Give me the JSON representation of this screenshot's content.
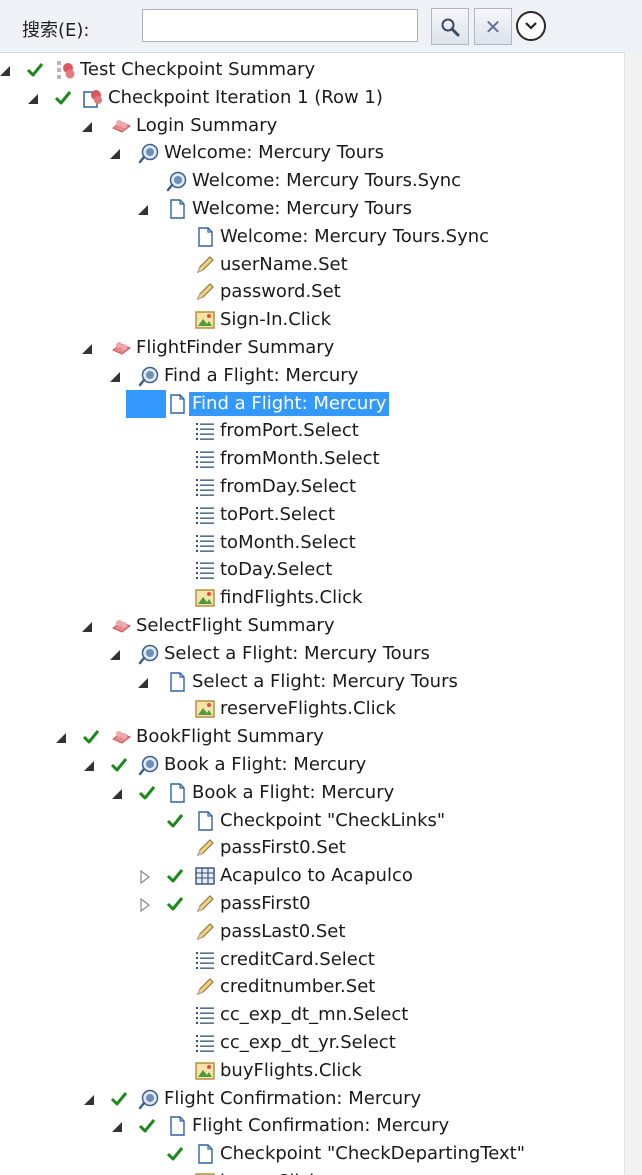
{
  "search": {
    "label": "搜索(E):",
    "value": "",
    "placeholder": ""
  },
  "toolbar": {
    "search_icon": "magnifier-icon",
    "clear_icon": "close-icon",
    "clear_glyph": "✕",
    "options_icon": "chevron-down-circle-icon"
  },
  "colors": {
    "selection": "#3399ff",
    "check": "#1a8a1a",
    "expander": "#333333"
  },
  "rows": [
    {
      "level": 0,
      "expander": "expanded",
      "check": true,
      "icon": "test-summary-icon",
      "label": "Test Checkpoint Summary"
    },
    {
      "level": 1,
      "expander": "expanded",
      "check": true,
      "icon": "iteration-icon",
      "label": "Checkpoint Iteration 1 (Row 1)"
    },
    {
      "level": 2,
      "expander": "expanded",
      "check": false,
      "icon": "action-icon",
      "label": "Login Summary"
    },
    {
      "level": 3,
      "expander": "expanded",
      "check": false,
      "icon": "browser-icon",
      "label": "Welcome: Mercury Tours"
    },
    {
      "level": 4,
      "expander": "none",
      "check": false,
      "icon": "browser-icon",
      "label": "Welcome: Mercury Tours.Sync"
    },
    {
      "level": 4,
      "expander": "expanded",
      "check": false,
      "icon": "page-icon",
      "label": "Welcome: Mercury Tours"
    },
    {
      "level": 5,
      "expander": "none",
      "check": false,
      "icon": "page-icon",
      "label": "Welcome: Mercury Tours.Sync"
    },
    {
      "level": 5,
      "expander": "none",
      "check": false,
      "icon": "edit-icon",
      "label": "userName.Set"
    },
    {
      "level": 5,
      "expander": "none",
      "check": false,
      "icon": "edit-icon",
      "label": "password.Set"
    },
    {
      "level": 5,
      "expander": "none",
      "check": false,
      "icon": "image-icon",
      "label": "Sign-In.Click"
    },
    {
      "level": 2,
      "expander": "expanded",
      "check": false,
      "icon": "action-icon",
      "label": "FlightFinder Summary"
    },
    {
      "level": 3,
      "expander": "expanded",
      "check": false,
      "icon": "browser-icon",
      "label": "Find a Flight: Mercury"
    },
    {
      "level": 4,
      "expander": "expanded",
      "check": false,
      "icon": "page-icon",
      "label": "Find a Flight: Mercury",
      "selected": true
    },
    {
      "level": 5,
      "expander": "none",
      "check": false,
      "icon": "list-icon",
      "label": "fromPort.Select"
    },
    {
      "level": 5,
      "expander": "none",
      "check": false,
      "icon": "list-icon",
      "label": "fromMonth.Select"
    },
    {
      "level": 5,
      "expander": "none",
      "check": false,
      "icon": "list-icon",
      "label": "fromDay.Select"
    },
    {
      "level": 5,
      "expander": "none",
      "check": false,
      "icon": "list-icon",
      "label": "toPort.Select"
    },
    {
      "level": 5,
      "expander": "none",
      "check": false,
      "icon": "list-icon",
      "label": "toMonth.Select"
    },
    {
      "level": 5,
      "expander": "none",
      "check": false,
      "icon": "list-icon",
      "label": "toDay.Select"
    },
    {
      "level": 5,
      "expander": "none",
      "check": false,
      "icon": "image-icon",
      "label": "findFlights.Click"
    },
    {
      "level": 2,
      "expander": "expanded",
      "check": false,
      "icon": "action-icon",
      "label": "SelectFlight Summary"
    },
    {
      "level": 3,
      "expander": "expanded",
      "check": false,
      "icon": "browser-icon",
      "label": "Select a Flight: Mercury Tours"
    },
    {
      "level": 4,
      "expander": "expanded",
      "check": false,
      "icon": "page-icon",
      "label": "Select a Flight: Mercury Tours"
    },
    {
      "level": 5,
      "expander": "none",
      "check": false,
      "icon": "image-icon",
      "label": "reserveFlights.Click"
    },
    {
      "level": 2,
      "expander": "expanded",
      "check": true,
      "icon": "action-icon",
      "label": "BookFlight Summary"
    },
    {
      "level": 3,
      "expander": "expanded",
      "check": true,
      "icon": "browser-icon",
      "label": "Book a Flight: Mercury"
    },
    {
      "level": 4,
      "expander": "expanded",
      "check": true,
      "icon": "page-icon",
      "label": "Book a Flight: Mercury"
    },
    {
      "level": 5,
      "expander": "none",
      "check": true,
      "icon": "page-icon",
      "label": "Checkpoint \"CheckLinks\""
    },
    {
      "level": 5,
      "expander": "none",
      "check": false,
      "icon": "edit-icon",
      "label": "passFirst0.Set"
    },
    {
      "level": 5,
      "expander": "collapsed",
      "check": true,
      "icon": "table-icon",
      "label": "Acapulco to Acapulco"
    },
    {
      "level": 5,
      "expander": "collapsed",
      "check": true,
      "icon": "edit-icon",
      "label": "passFirst0"
    },
    {
      "level": 5,
      "expander": "none",
      "check": false,
      "icon": "edit-icon",
      "label": "passLast0.Set"
    },
    {
      "level": 5,
      "expander": "none",
      "check": false,
      "icon": "list-icon",
      "label": "creditCard.Select"
    },
    {
      "level": 5,
      "expander": "none",
      "check": false,
      "icon": "edit-icon",
      "label": "creditnumber.Set"
    },
    {
      "level": 5,
      "expander": "none",
      "check": false,
      "icon": "list-icon",
      "label": "cc_exp_dt_mn.Select"
    },
    {
      "level": 5,
      "expander": "none",
      "check": false,
      "icon": "list-icon",
      "label": "cc_exp_dt_yr.Select"
    },
    {
      "level": 5,
      "expander": "none",
      "check": false,
      "icon": "image-icon",
      "label": "buyFlights.Click"
    },
    {
      "level": 3,
      "expander": "expanded",
      "check": true,
      "icon": "browser-icon",
      "label": "Flight Confirmation: Mercury"
    },
    {
      "level": 4,
      "expander": "expanded",
      "check": true,
      "icon": "page-icon",
      "label": "Flight Confirmation: Mercury"
    },
    {
      "level": 5,
      "expander": "none",
      "check": true,
      "icon": "page-icon",
      "label": "Checkpoint \"CheckDepartingText\""
    },
    {
      "level": 5,
      "expander": "none",
      "check": false,
      "icon": "image-icon",
      "label": "home.Click"
    }
  ]
}
